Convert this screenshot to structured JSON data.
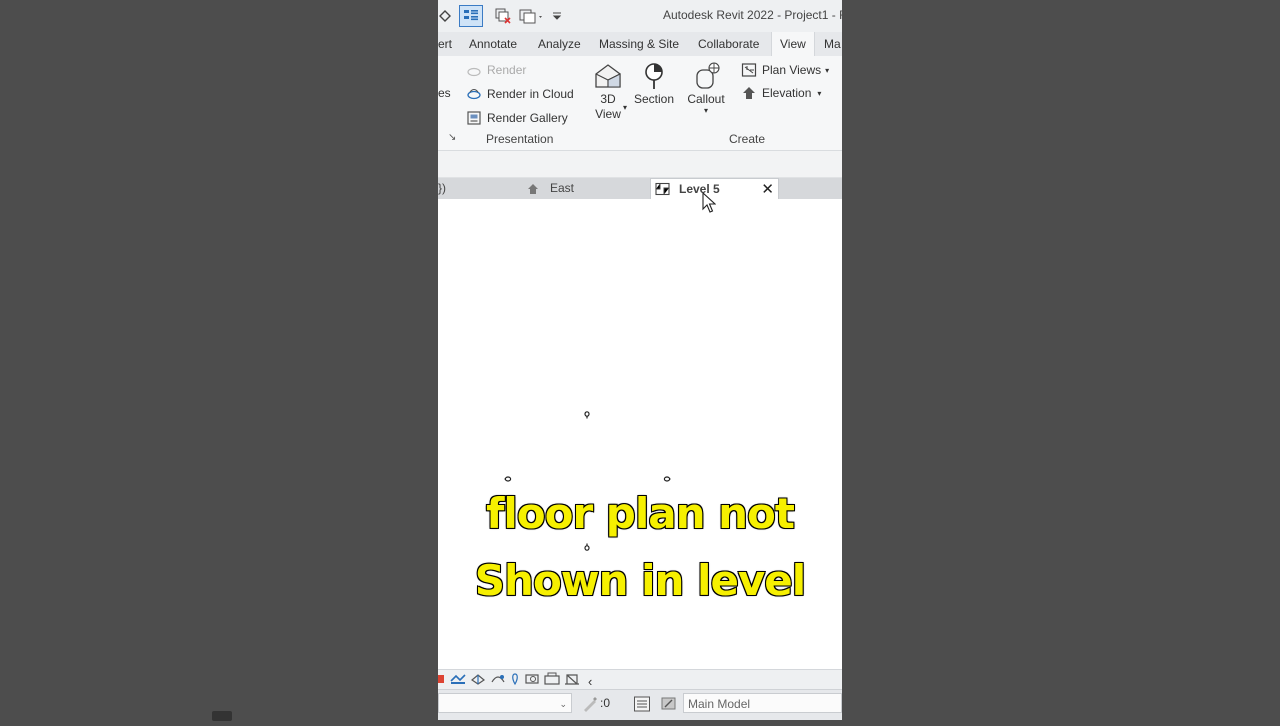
{
  "window": {
    "title": "Autodesk Revit 2022 - Project1 - F"
  },
  "ribbon_tabs": [
    {
      "label": "ert",
      "active": false
    },
    {
      "label": "Annotate",
      "active": false
    },
    {
      "label": "Analyze",
      "active": false
    },
    {
      "label": "Massing & Site",
      "active": false
    },
    {
      "label": "Collaborate",
      "active": false
    },
    {
      "label": "View",
      "active": true
    },
    {
      "label": "Ma",
      "active": false
    }
  ],
  "ribbon": {
    "cut_label": "es",
    "render": "Render",
    "render_in_cloud": "Render  in Cloud",
    "render_gallery": "Render  Gallery",
    "presentation_panel": "Presentation",
    "view_3d_line1": "3D",
    "view_3d_line2": "View",
    "section": "Section",
    "callout": "Callout",
    "plan_views": "Plan  Views",
    "elevation": "Elevation",
    "create_panel": "Create"
  },
  "view_tabs": [
    {
      "label": "})",
      "active": false,
      "icon": "partial"
    },
    {
      "label": "East",
      "active": false,
      "icon": "elevation-icon"
    },
    {
      "label": "Level 5",
      "active": true,
      "icon": "floor-plan-icon"
    }
  ],
  "caption": {
    "line1": "floor plan not",
    "line2": "Shown in level"
  },
  "status": {
    "scale_value": ":0",
    "model": "Main Model"
  },
  "colors": {
    "caption_fill": "#f6f000",
    "caption_stroke": "#111111",
    "accent_blue": "#2a6fb8"
  }
}
